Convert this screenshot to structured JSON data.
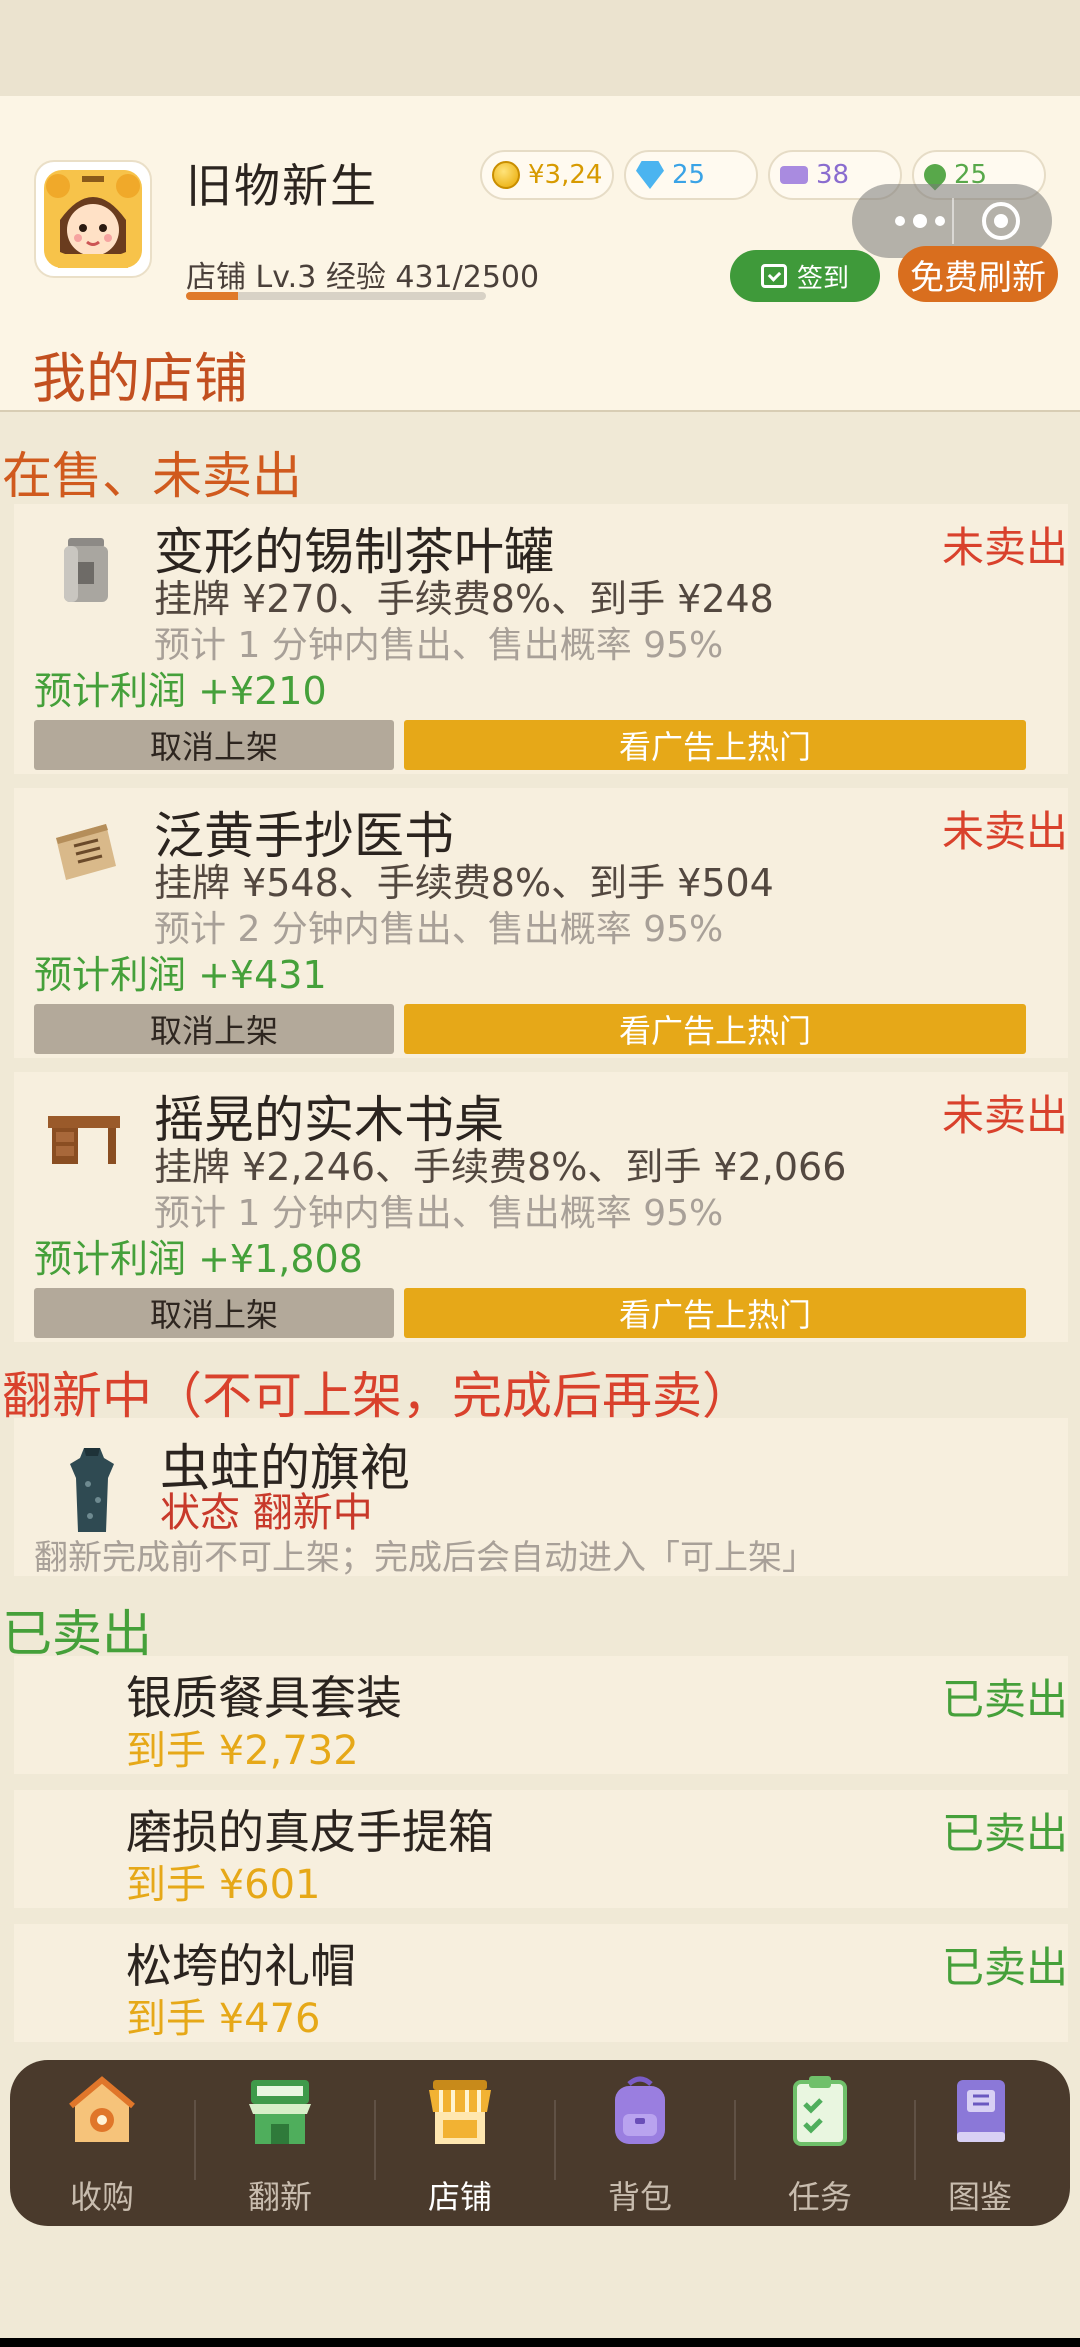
{
  "app": {
    "title": "旧物新生",
    "shop_level": "店铺 Lv.3  经验 431/2500",
    "xp_progress": 0.172
  },
  "currencies": [
    {
      "icon": "gold-coin-icon",
      "value": "¥3,24",
      "color": "#d79a00"
    },
    {
      "icon": "diamond-icon",
      "value": "25",
      "color": "#3aa3e6"
    },
    {
      "icon": "ticket-icon",
      "value": "38",
      "color": "#8a6ccf"
    },
    {
      "icon": "leaf-icon",
      "value": "25",
      "color": "#58a84a"
    }
  ],
  "header_buttons": {
    "signin": "签到",
    "free_refresh": "免费刷新"
  },
  "page_title": "我的店铺",
  "sections": {
    "on_sale": "在售、未卖出",
    "refurbishing": "翻新中（不可上架，完成后再卖）",
    "sold": "已卖出"
  },
  "listings": [
    {
      "name": "变形的锡制茶叶罐",
      "icon": "tea-tin-icon",
      "price_line": "挂牌 ¥270、手续费8%、到手 ¥248",
      "eta": "预计 1 分钟内售出、售出概率 95%",
      "profit": "预计利润 +¥210",
      "status": "未卖出",
      "cancel_label": "取消上架",
      "ad_label": "看广告上热门"
    },
    {
      "name": "泛黄手抄医书",
      "icon": "old-book-icon",
      "price_line": "挂牌 ¥548、手续费8%、到手 ¥504",
      "eta": "预计 2 分钟内售出、售出概率 95%",
      "profit": "预计利润 +¥431",
      "status": "未卖出",
      "cancel_label": "取消上架",
      "ad_label": "看广告上热门"
    },
    {
      "name": "摇晃的实木书桌",
      "icon": "wooden-desk-icon",
      "price_line": "挂牌 ¥2,246、手续费8%、到手 ¥2,066",
      "eta": "预计 1 分钟内售出、售出概率 95%",
      "profit": "预计利润 +¥1,808",
      "status": "未卖出",
      "cancel_label": "取消上架",
      "ad_label": "看广告上热门"
    }
  ],
  "refurbishing": {
    "name": "虫蛀的旗袍",
    "icon": "qipao-icon",
    "status": "状态 翻新中",
    "note": "翻新完成前不可上架；完成后会自动进入「可上架」"
  },
  "sold_items": [
    {
      "name": "银质餐具套装",
      "amount": "到手 ¥2,732",
      "status": "已卖出"
    },
    {
      "name": "磨损的真皮手提箱",
      "amount": "到手 ¥601",
      "status": "已卖出"
    },
    {
      "name": "松垮的礼帽",
      "amount": "到手 ¥476",
      "status": "已卖出"
    }
  ],
  "tabs": [
    {
      "label": "收购",
      "icon": "acquire-icon",
      "color": "#f0a33a"
    },
    {
      "label": "翻新",
      "icon": "refurbish-shop-icon",
      "color": "#4fae5c"
    },
    {
      "label": "店铺",
      "icon": "store-icon",
      "color": "#f2b233",
      "active": true
    },
    {
      "label": "背包",
      "icon": "backpack-icon",
      "color": "#9a7ee0"
    },
    {
      "label": "任务",
      "icon": "task-clipboard-icon",
      "color": "#6fc06a"
    },
    {
      "label": "图鉴",
      "icon": "codex-book-icon",
      "color": "#8b78d8"
    }
  ]
}
